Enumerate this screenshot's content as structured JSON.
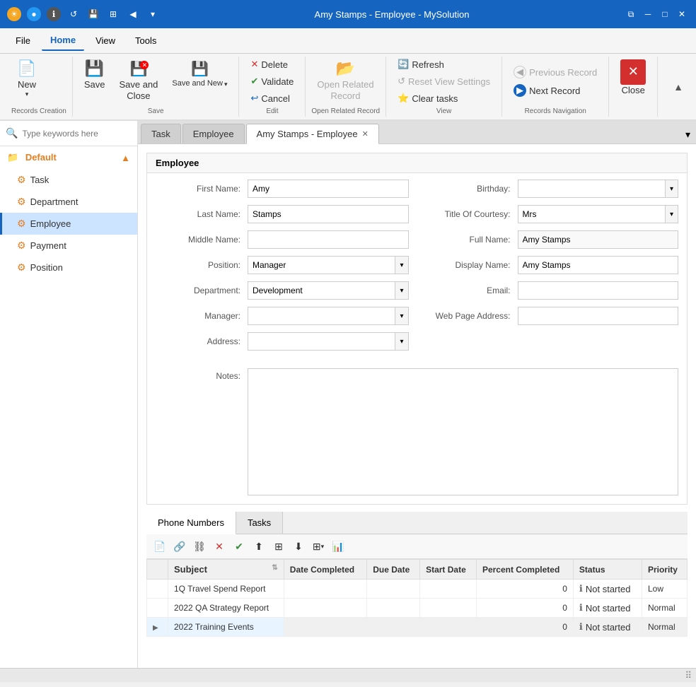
{
  "titleBar": {
    "title": "Amy Stamps - Employee - MySolution",
    "controls": [
      "restore",
      "minimize",
      "maximize",
      "close"
    ]
  },
  "menuBar": {
    "items": [
      "File",
      "Home",
      "View",
      "Tools"
    ],
    "active": "Home"
  },
  "ribbon": {
    "groups": [
      {
        "label": "Records Creation",
        "buttons": [
          {
            "id": "new",
            "label": "New",
            "icon": "📄",
            "hasDropdown": true
          }
        ]
      },
      {
        "label": "Save",
        "buttons": [
          {
            "id": "save",
            "label": "Save",
            "icon": "💾"
          },
          {
            "id": "save-close",
            "label": "Save and\nClose",
            "icon": "💾"
          },
          {
            "id": "save-new",
            "label": "Save and New",
            "icon": "💾",
            "hasDropdown": true
          }
        ]
      },
      {
        "label": "Edit",
        "buttons_small": [
          {
            "id": "delete",
            "label": "Delete",
            "icon": "✖",
            "color": "red"
          },
          {
            "id": "validate",
            "label": "Validate",
            "icon": "✔",
            "color": "green"
          },
          {
            "id": "cancel",
            "label": "Cancel",
            "icon": "↩",
            "color": "blue"
          }
        ]
      },
      {
        "label": "Open Related Record",
        "buttons": [
          {
            "id": "open-related",
            "label": "Open Related\nRecord",
            "icon": "📂",
            "disabled": true
          }
        ]
      },
      {
        "label": "View",
        "buttons_small": [
          {
            "id": "refresh",
            "label": "Refresh",
            "icon": "🔄",
            "color": "green"
          },
          {
            "id": "reset-view",
            "label": "Reset View Settings",
            "icon": "↺",
            "disabled": true
          },
          {
            "id": "clear-tasks",
            "label": "Clear tasks",
            "icon": "⭐",
            "color": "orange"
          }
        ]
      },
      {
        "label": "Records Navigation",
        "buttons_small": [
          {
            "id": "prev-record",
            "label": "Previous Record",
            "icon": "◀",
            "disabled": true
          },
          {
            "id": "next-record",
            "label": "Next Record",
            "icon": "●"
          }
        ]
      },
      {
        "label": "Close",
        "buttons": [
          {
            "id": "close",
            "label": "Close",
            "icon": "✖",
            "color": "red"
          }
        ]
      }
    ]
  },
  "search": {
    "placeholder": "Type keywords here"
  },
  "sidebar": {
    "folderLabel": "Default",
    "items": [
      {
        "id": "task",
        "label": "Task"
      },
      {
        "id": "department",
        "label": "Department"
      },
      {
        "id": "employee",
        "label": "Employee",
        "active": true
      },
      {
        "id": "payment",
        "label": "Payment"
      },
      {
        "id": "position",
        "label": "Position"
      }
    ]
  },
  "tabs": {
    "items": [
      {
        "id": "task",
        "label": "Task",
        "closeable": false
      },
      {
        "id": "employee",
        "label": "Employee",
        "closeable": false
      },
      {
        "id": "amy-stamps",
        "label": "Amy Stamps - Employee",
        "closeable": true,
        "active": true
      }
    ]
  },
  "form": {
    "sectionTitle": "Employee",
    "fields": {
      "firstName": {
        "label": "First Name:",
        "value": "Amy"
      },
      "birthday": {
        "label": "Birthday:",
        "value": ""
      },
      "lastName": {
        "label": "Last Name:",
        "value": "Stamps"
      },
      "titleOfCourtesy": {
        "label": "Title Of Courtesy:",
        "value": "Mrs"
      },
      "middleName": {
        "label": "Middle Name:",
        "value": ""
      },
      "fullName": {
        "label": "Full Name:",
        "value": "Amy Stamps"
      },
      "position": {
        "label": "Position:",
        "value": "Manager"
      },
      "displayName": {
        "label": "Display Name:",
        "value": "Amy Stamps"
      },
      "department": {
        "label": "Department:",
        "value": "Development"
      },
      "email": {
        "label": "Email:",
        "value": ""
      },
      "manager": {
        "label": "Manager:",
        "value": ""
      },
      "webPageAddress": {
        "label": "Web Page Address:",
        "value": ""
      },
      "address": {
        "label": "Address:",
        "value": ""
      }
    },
    "notes": {
      "label": "Notes:",
      "value": ""
    }
  },
  "subTabs": [
    {
      "id": "phone-numbers",
      "label": "Phone Numbers",
      "active": true
    },
    {
      "id": "tasks",
      "label": "Tasks"
    }
  ],
  "gridToolbar": {
    "buttons": [
      "new-doc",
      "link",
      "unlink",
      "delete-red",
      "check-green",
      "upload",
      "multiselect",
      "download",
      "options",
      "report"
    ]
  },
  "grid": {
    "columns": [
      "Subject",
      "Date Completed",
      "Due Date",
      "Start Date",
      "Percent Completed",
      "Status",
      "Priority"
    ],
    "rows": [
      {
        "subject": "1Q Travel Spend Report",
        "dateCompleted": "",
        "dueDate": "",
        "startDate": "",
        "percentCompleted": "0",
        "status": "Not started",
        "priority": "Low",
        "expanded": false
      },
      {
        "subject": "2022 QA Strategy Report",
        "dateCompleted": "",
        "dueDate": "",
        "startDate": "",
        "percentCompleted": "0",
        "status": "Not started",
        "priority": "Normal",
        "expanded": false
      },
      {
        "subject": "2022 Training Events",
        "dateCompleted": "",
        "dueDate": "",
        "startDate": "",
        "percentCompleted": "0",
        "status": "Not started",
        "priority": "Normal",
        "expanded": true
      }
    ]
  }
}
